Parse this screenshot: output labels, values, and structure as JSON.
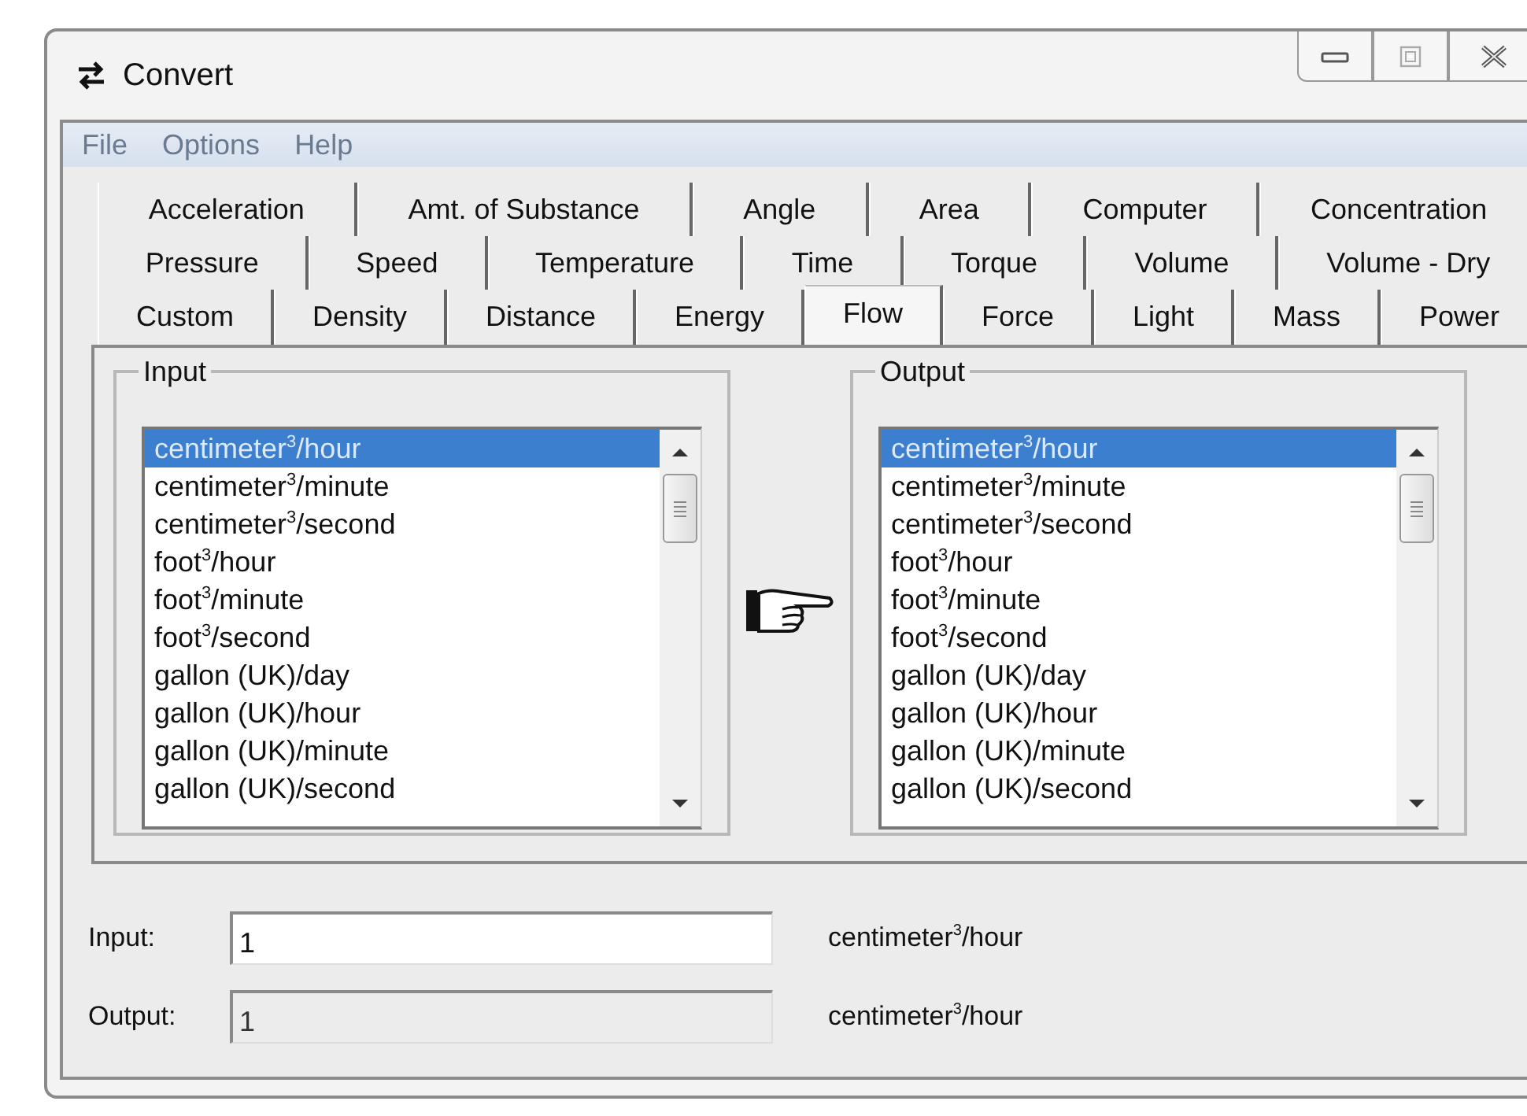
{
  "window": {
    "title": "Convert"
  },
  "menu": [
    "File",
    "Options",
    "Help"
  ],
  "tab_rows": [
    [
      {
        "label": "Acceleration",
        "selected": false
      },
      {
        "label": "Amt. of Substance",
        "selected": false
      },
      {
        "label": "Angle",
        "selected": false
      },
      {
        "label": "Area",
        "selected": false
      },
      {
        "label": "Computer",
        "selected": false
      },
      {
        "label": "Concentration",
        "selected": false
      }
    ],
    [
      {
        "label": "Pressure",
        "selected": false
      },
      {
        "label": "Speed",
        "selected": false
      },
      {
        "label": "Temperature",
        "selected": false
      },
      {
        "label": "Time",
        "selected": false
      },
      {
        "label": "Torque",
        "selected": false
      },
      {
        "label": "Volume",
        "selected": false
      },
      {
        "label": "Volume - Dry",
        "selected": false
      }
    ],
    [
      {
        "label": "Custom",
        "selected": false
      },
      {
        "label": "Density",
        "selected": false
      },
      {
        "label": "Distance",
        "selected": false
      },
      {
        "label": "Energy",
        "selected": false
      },
      {
        "label": "Flow",
        "selected": true
      },
      {
        "label": "Force",
        "selected": false
      },
      {
        "label": "Light",
        "selected": false
      },
      {
        "label": "Mass",
        "selected": false
      },
      {
        "label": "Power",
        "selected": false
      }
    ]
  ],
  "lists": [
    {
      "title": "Input",
      "items": [
        {
          "label": "centimeter$^{3}$/hour",
          "selected": true
        },
        {
          "label": "centimeter$^{3}$/minute",
          "selected": false
        },
        {
          "label": "centimeter$^{3}$/second",
          "selected": false
        },
        {
          "label": "foot$^{3}$/hour",
          "selected": false
        },
        {
          "label": "foot$^{3}$/minute",
          "selected": false
        },
        {
          "label": "foot$^{3}$/second",
          "selected": false
        },
        {
          "label": "gallon (UK)/day",
          "selected": false
        },
        {
          "label": "gallon (UK)/hour",
          "selected": false
        },
        {
          "label": "gallon (UK)/minute",
          "selected": false
        },
        {
          "label": "gallon (UK)/second",
          "selected": false
        }
      ]
    },
    {
      "title": "Output",
      "items": [
        {
          "label": "centimeter$^{3}$/hour",
          "selected": true
        },
        {
          "label": "centimeter$^{3}$/minute",
          "selected": false
        },
        {
          "label": "centimeter$^{3}$/second",
          "selected": false
        },
        {
          "label": "foot$^{3}$/hour",
          "selected": false
        },
        {
          "label": "foot$^{3}$/minute",
          "selected": false
        },
        {
          "label": "foot$^{3}$/second",
          "selected": false
        },
        {
          "label": "gallon (UK)/day",
          "selected": false
        },
        {
          "label": "gallon (UK)/hour",
          "selected": false
        },
        {
          "label": "gallon (UK)/minute",
          "selected": false
        },
        {
          "label": "gallon (UK)/second",
          "selected": false
        }
      ]
    }
  ],
  "fields": [
    {
      "label": "Input:",
      "value": "1",
      "disabled": false,
      "unit": "centimeter$^{3}$/hour"
    },
    {
      "label": "Output:",
      "value": "1",
      "disabled": true,
      "unit": "centimeter$^{3}$/hour"
    }
  ]
}
